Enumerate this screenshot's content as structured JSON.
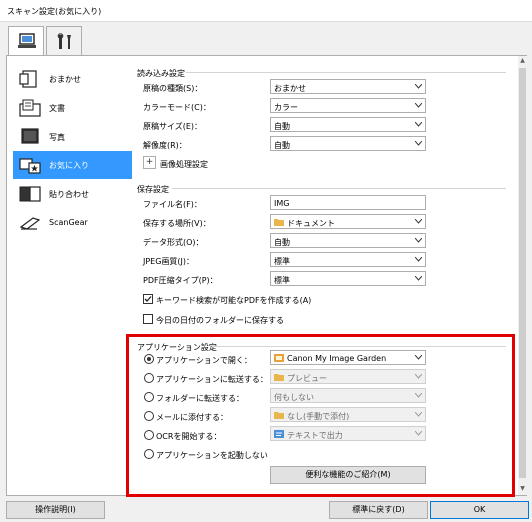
{
  "window": {
    "title": "スキャン設定(お気に入り)"
  },
  "top_tabs": [
    {
      "icon": "scan-from-computer-icon",
      "active": true
    },
    {
      "icon": "general-settings-tools-icon",
      "active": false
    }
  ],
  "sidebar": {
    "items": [
      {
        "label": "おまかせ",
        "icon": "auto-scan-icon",
        "active": false
      },
      {
        "label": "文書",
        "icon": "document-scan-icon",
        "active": false
      },
      {
        "label": "写真",
        "icon": "photo-scan-icon",
        "active": false
      },
      {
        "label": "お気に入り",
        "icon": "favorite-scan-icon",
        "active": true
      },
      {
        "label": "貼り合わせ",
        "icon": "stitch-scan-icon",
        "active": false
      },
      {
        "label": "ScanGear",
        "icon": "scangear-icon",
        "active": false
      }
    ]
  },
  "scan_options": {
    "title": "読み込み設定",
    "rows": [
      {
        "label": "原稿の種類(S)：",
        "value": "おまかせ"
      },
      {
        "label": "カラーモード(C)：",
        "value": "カラー"
      },
      {
        "label": "原稿サイズ(E)：",
        "value": "自動"
      },
      {
        "label": "解像度(R)：",
        "value": "自動"
      }
    ],
    "image_processing_label": "画像処理設定"
  },
  "save_settings": {
    "title": "保存設定",
    "file_name_label": "ファイル名(F)：",
    "file_name_value": "IMG",
    "rows": [
      {
        "label": "保存する場所(V)：",
        "value": "ドキュメント",
        "icon": "folder-icon"
      },
      {
        "label": "データ形式(O)：",
        "value": "自動"
      },
      {
        "label": "JPEG画質(J)：",
        "value": "標準"
      },
      {
        "label": "PDF圧縮タイプ(P)：",
        "value": "標準"
      }
    ],
    "checkboxes": [
      {
        "label": "キーワード検索が可能なPDFを作成する(A)",
        "checked": true
      },
      {
        "label": "今日の日付のフォルダーに保存する",
        "checked": false
      }
    ]
  },
  "app_settings": {
    "title": "アプリケーション設定",
    "options": [
      {
        "label": "アプリケーションで開く：",
        "value": "Canon My Image Garden",
        "icon": "image-garden-icon",
        "selected": true,
        "enabled": true
      },
      {
        "label": "アプリケーションに転送する：",
        "value": "プレビュー",
        "icon": "folder-icon",
        "selected": false,
        "enabled": false
      },
      {
        "label": "フォルダーに転送する：",
        "value": "何もしない",
        "icon": "",
        "selected": false,
        "enabled": false
      },
      {
        "label": "メールに添付する：",
        "value": "なし(手動で添付)",
        "icon": "folder-icon",
        "selected": false,
        "enabled": false
      },
      {
        "label": "OCRを開始する：",
        "value": "テキストで出力",
        "icon": "ocr-text-icon",
        "selected": false,
        "enabled": false
      },
      {
        "label": "アプリケーションを起動しない",
        "value": "",
        "icon": "",
        "selected": false,
        "enabled": true
      }
    ],
    "more_functions_label": "便利な機能のご紹介(M)"
  },
  "footer": {
    "instructions_label": "操作説明(I)",
    "defaults_label": "標準に戻す(D)",
    "ok_label": "OK"
  },
  "colors": {
    "accent": "#3399ff",
    "highlight_border": "#e00000"
  }
}
